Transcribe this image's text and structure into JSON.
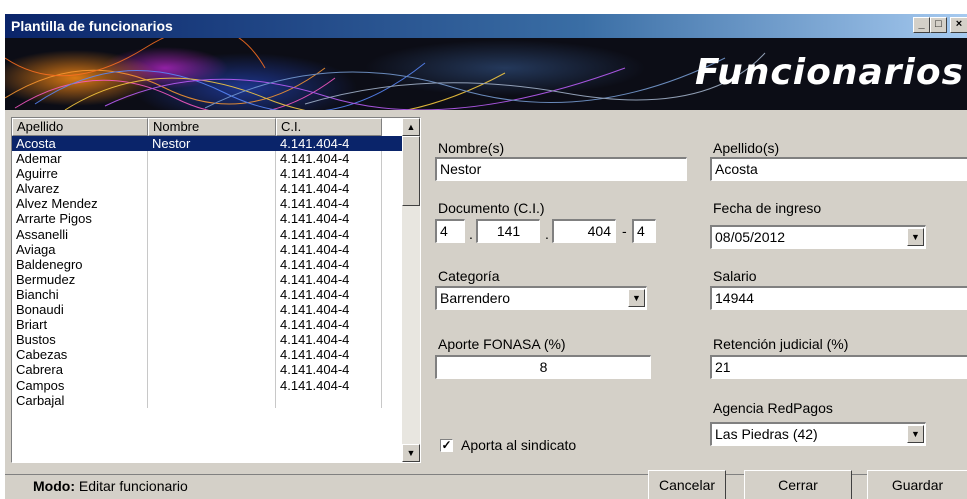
{
  "window": {
    "title": "Plantilla de funcionarios",
    "buttons": {
      "minimize": "_",
      "maximize": "□",
      "close": "×"
    }
  },
  "banner": {
    "title": "Funcionarios"
  },
  "list": {
    "columns": [
      "Apellido",
      "Nombre",
      "C.I."
    ],
    "rows": [
      {
        "apellido": "Acosta",
        "nombre": "Nestor",
        "ci": "4.141.404-4"
      },
      {
        "apellido": "Ademar",
        "nombre": "",
        "ci": "4.141.404-4"
      },
      {
        "apellido": "Aguirre",
        "nombre": "",
        "ci": "4.141.404-4"
      },
      {
        "apellido": "Alvarez",
        "nombre": "",
        "ci": "4.141.404-4"
      },
      {
        "apellido": "Alvez Mendez",
        "nombre": "",
        "ci": "4.141.404-4"
      },
      {
        "apellido": "Arrarte Pigos",
        "nombre": "",
        "ci": "4.141.404-4"
      },
      {
        "apellido": "Assanelli",
        "nombre": "",
        "ci": "4.141.404-4"
      },
      {
        "apellido": "Aviaga",
        "nombre": "",
        "ci": "4.141.404-4"
      },
      {
        "apellido": "Baldenegro",
        "nombre": "",
        "ci": "4.141.404-4"
      },
      {
        "apellido": "Bermudez",
        "nombre": "",
        "ci": "4.141.404-4"
      },
      {
        "apellido": "Bianchi",
        "nombre": "",
        "ci": "4.141.404-4"
      },
      {
        "apellido": "Bonaudi",
        "nombre": "",
        "ci": "4.141.404-4"
      },
      {
        "apellido": "Briart",
        "nombre": "",
        "ci": "4.141.404-4"
      },
      {
        "apellido": "Bustos",
        "nombre": "",
        "ci": "4.141.404-4"
      },
      {
        "apellido": "Cabezas",
        "nombre": "",
        "ci": "4.141.404-4"
      },
      {
        "apellido": "Cabrera",
        "nombre": "",
        "ci": "4.141.404-4"
      },
      {
        "apellido": "Campos",
        "nombre": "",
        "ci": "4.141.404-4"
      },
      {
        "apellido": "Carbajal",
        "nombre": "",
        "ci": ""
      }
    ],
    "selected_index": 0
  },
  "form": {
    "nombre_label": "Nombre(s)",
    "nombre_value": "Nestor",
    "apellido_label": "Apellido(s)",
    "apellido_value": "Acosta",
    "documento_label": "Documento (C.I.)",
    "documento_parts": [
      "4",
      "141",
      "404",
      "4"
    ],
    "documento_seps": [
      ".",
      ".",
      "-"
    ],
    "fecha_label": "Fecha de ingreso",
    "fecha_value": "08/05/2012",
    "categoria_label": "Categoría",
    "categoria_value": "Barrendero",
    "salario_label": "Salario",
    "salario_value": "14944",
    "fonasa_label": "Aporte FONASA (%)",
    "fonasa_value": "8",
    "retencion_label": "Retención judicial (%)",
    "retencion_value": "21",
    "agencia_label": "Agencia RedPagos",
    "agencia_value": "Las Piedras (42)",
    "sindicato_label": "Aporta al sindicato",
    "sindicato_checked": true
  },
  "status": {
    "mode_label": "Modo:",
    "mode_value": "Editar funcionario"
  },
  "actions": {
    "cancel": "Cancelar",
    "close": "Cerrar",
    "save": "Guardar"
  }
}
